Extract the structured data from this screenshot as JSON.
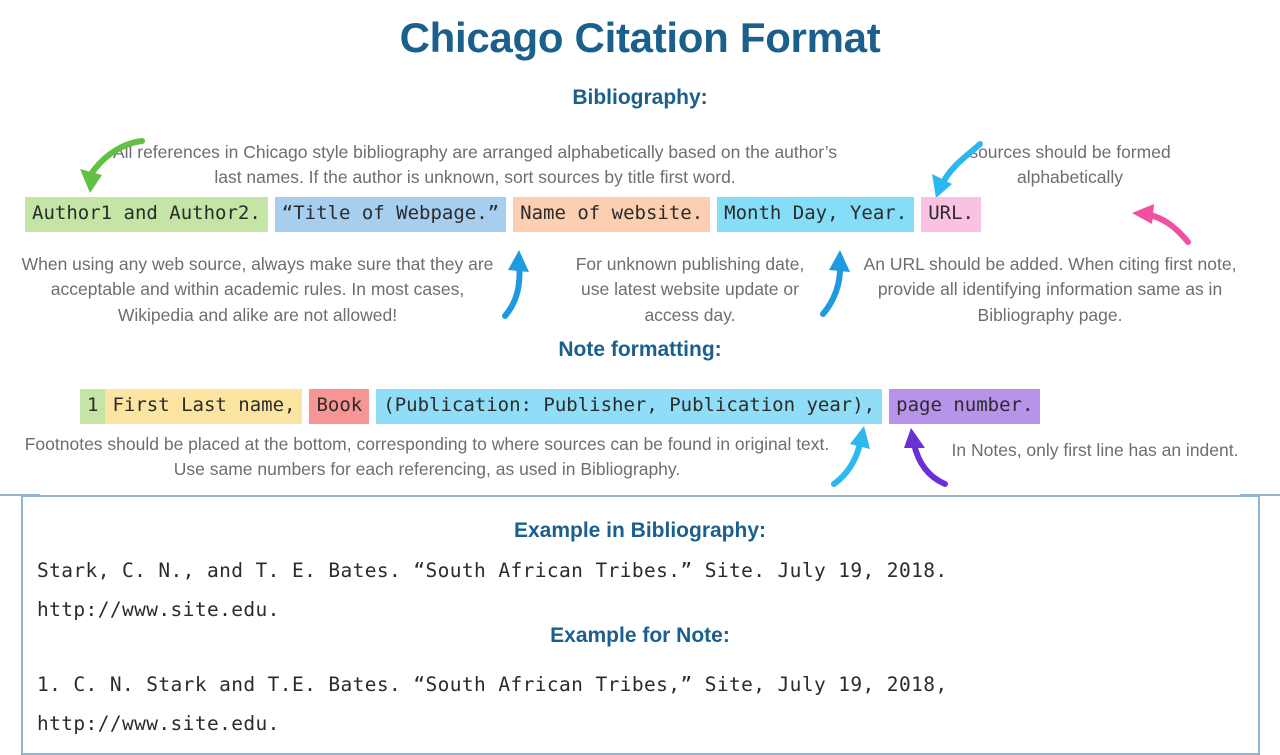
{
  "title": "Chicago Citation Format",
  "sections": {
    "bibliography_heading": "Bibliography:",
    "note_heading": "Note formatting:",
    "example_bibliography_heading": "Example in Bibliography:",
    "example_note_heading": "Example for Note:"
  },
  "annotations": {
    "authors_note": "All references in Chicago style bibliography are arranged alphabetically based on the author’s last names. If the author is unknown, sort sources by title first word.",
    "alphabetical_note": "sources should be formed alphabetically",
    "web_source_note": "When using any web source, always make sure that they are acceptable and within academic rules. In most cases, Wikipedia and alike are not allowed!",
    "publishing_date_note": "For unknown publishing date, use latest website update or access day.",
    "url_note": "An URL should be added. When citing first note, provide all identifying information same as in Bibliography page.",
    "footnote_note": "Footnotes should be placed at the bottom, corresponding to where sources can be found in original text. Use same numbers for each referencing, as used in Bibliography.",
    "indent_note": "In Notes, only first line has an indent."
  },
  "bibliography_template": [
    {
      "text": "Author1 and Author2.",
      "color": "#c4e5a6",
      "swatch": "green"
    },
    {
      "text": "“Title of Webpage.”",
      "color": "#a7cdef",
      "swatch": "blue"
    },
    {
      "text": "Name of website.",
      "color": "#fbcfaf",
      "swatch": "peach"
    },
    {
      "text": "Month Day, Year.",
      "color": "#85ddf7",
      "swatch": "cyan"
    },
    {
      "text": "URL.",
      "color": "#f9c1e2",
      "swatch": "pink"
    }
  ],
  "note_template": [
    {
      "text": "1",
      "color": "#c4e5a6",
      "swatch": "green"
    },
    {
      "text": "First Last name,",
      "color": "#fbe5a0",
      "swatch": "yellow"
    },
    {
      "text": "Book",
      "color": "#f79494",
      "swatch": "red"
    },
    {
      "text": "(Publication: Publisher, Publication year),",
      "color": "#90ddf7",
      "swatch": "cyan"
    },
    {
      "text": "page number.",
      "color": "#b793ea",
      "swatch": "purple"
    }
  ],
  "examples": {
    "bibliography_line1": "Stark, C. N., and T. E. Bates. “South African Tribes.” Site. July 19, 2018.",
    "bibliography_line2": "http://www.site.edu.",
    "note_line1": "1. C. N. Stark and T.E. Bates. “South African Tribes,” Site, July 19, 2018,",
    "note_line2": "http://www.site.edu."
  },
  "colors": {
    "heading": "#1b5f8c",
    "body_text": "#6d6e71",
    "box_border": "#93b4d1",
    "arrow_green": "#62c044",
    "arrow_cyan": "#2bb8ef",
    "arrow_blue": "#1f9ae0",
    "arrow_pink": "#f0509f",
    "arrow_purple": "#6a2fd6"
  },
  "arrows": [
    {
      "name": "green-arrow-to-author",
      "color": "#62c044",
      "points_to": "Author1 and Author2."
    },
    {
      "name": "cyan-arrow-to-date",
      "color": "#2bb8ef",
      "points_to": "Month Day, Year."
    },
    {
      "name": "pink-arrow-to-url",
      "color": "#f0509f",
      "points_to": "URL."
    },
    {
      "name": "blue-arrow-to-title",
      "color": "#1f9ae0",
      "points_to": "“Title of Webpage.”"
    },
    {
      "name": "blue-arrow-to-website",
      "color": "#1f9ae0",
      "points_to": "Name of website."
    },
    {
      "name": "cyan-arrow-to-publication",
      "color": "#2bb8ef",
      "points_to": "(Publication: Publisher, Publication year),"
    },
    {
      "name": "purple-arrow-to-page-number",
      "color": "#6a2fd6",
      "points_to": "page number."
    }
  ]
}
